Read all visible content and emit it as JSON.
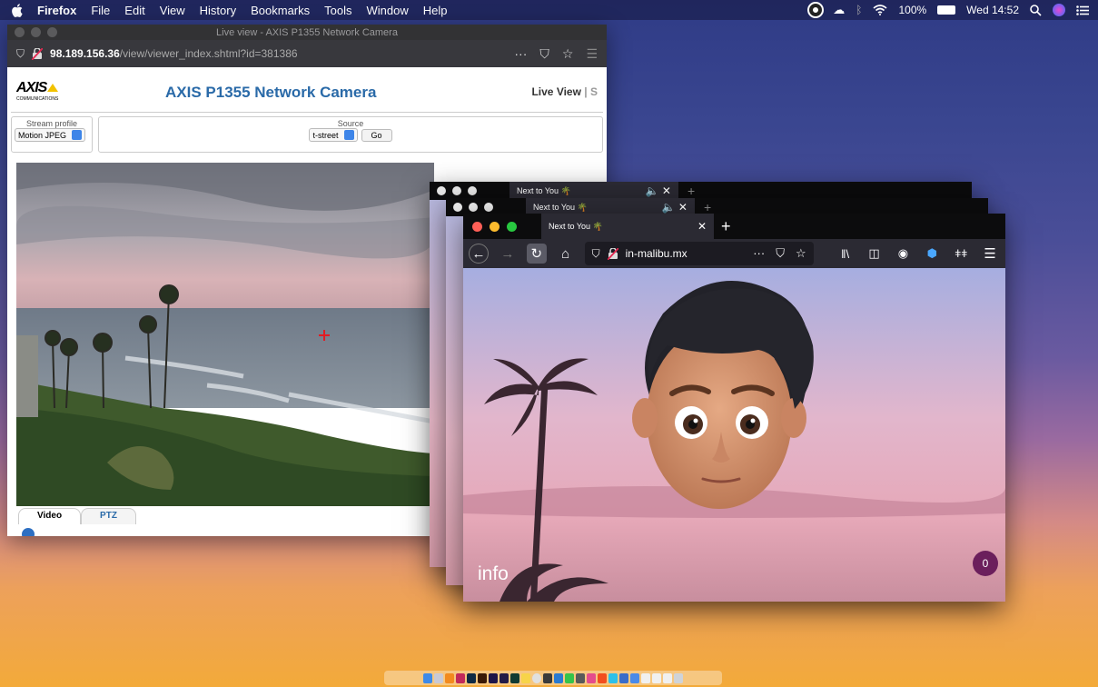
{
  "menubar": {
    "app": "Firefox",
    "items": [
      "File",
      "Edit",
      "View",
      "History",
      "Bookmarks",
      "Tools",
      "Window",
      "Help"
    ],
    "battery": "100%",
    "clock": "Wed 14:52"
  },
  "axis_window": {
    "title": "Live view - AXIS P1355 Network Camera",
    "url_host": "98.189.156.36",
    "url_path": "/view/viewer_index.shtml?id=381386",
    "logo": "AXIS",
    "logo_sub": "COMMUNICATIONS",
    "heading": "AXIS P1355 Network Camera",
    "live_view": "Live View",
    "stream_profile_label": "Stream profile",
    "stream_profile_value": "Motion JPEG",
    "source_label": "Source",
    "source_value": "t-street",
    "go_label": "Go",
    "tab_video": "Video",
    "tab_ptz": "PTZ"
  },
  "ff_windows": {
    "tab_title": "Next to You 🌴",
    "url": "in-malibu.mx",
    "info_label": "info",
    "badge_count": "0"
  },
  "colors": {
    "axis_blue": "#2a6aa8",
    "ff_dark": "#2b2a33",
    "badge": "#6b1f5c"
  }
}
